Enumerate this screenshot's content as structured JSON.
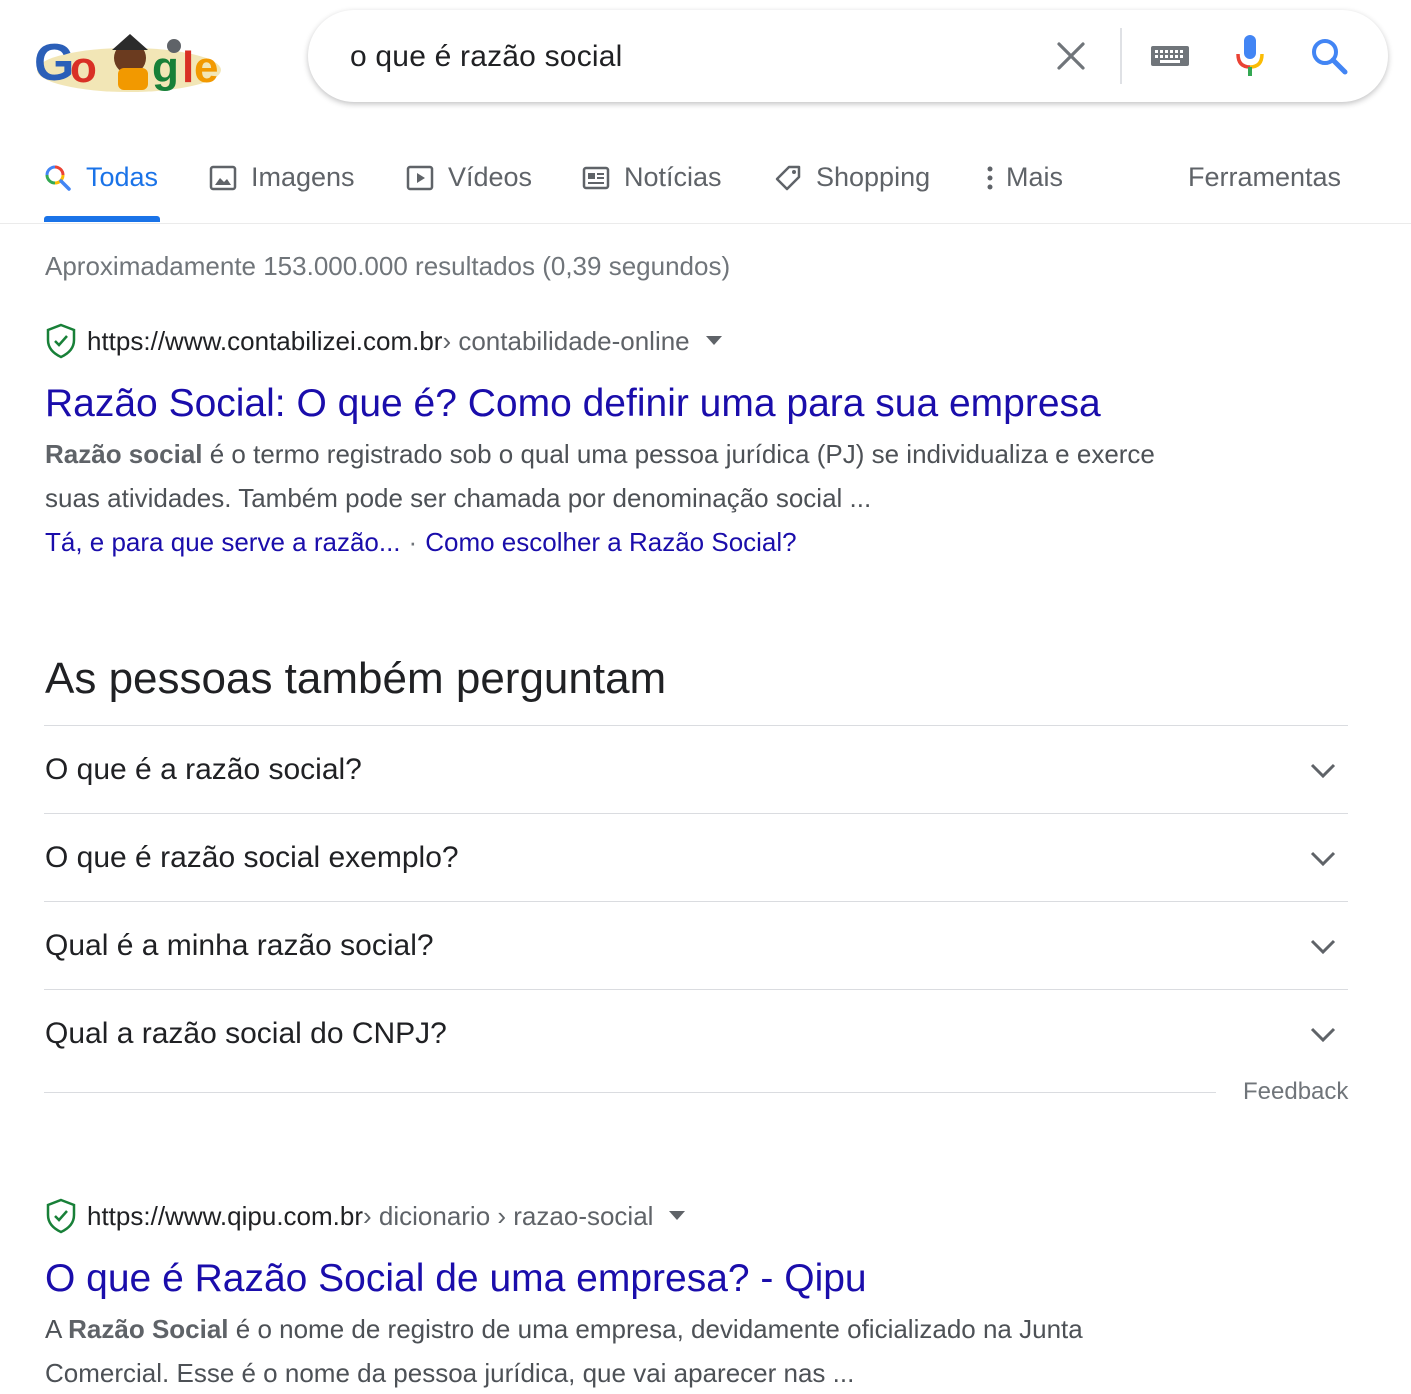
{
  "search": {
    "query": "o que é razão social"
  },
  "tabs": [
    {
      "label": "Todas",
      "icon": "search-icon",
      "active": true
    },
    {
      "label": "Imagens",
      "icon": "image-icon"
    },
    {
      "label": "Vídeos",
      "icon": "video-icon"
    },
    {
      "label": "Notícias",
      "icon": "news-icon"
    },
    {
      "label": "Shopping",
      "icon": "tag-icon"
    },
    {
      "label": "Mais",
      "icon": "more-vert-icon"
    }
  ],
  "tools_label": "Ferramentas",
  "stats": "Aproximadamente 153.000.000 resultados (0,39 segundos)",
  "results": [
    {
      "site": "https://www.contabilizei.com.br",
      "crumbs": " › contabilidade-online",
      "title": "Razão Social: O que é? Como definir uma para sua empresa",
      "snippet_bold": "Razão social",
      "snippet_line1_rest": " é o termo registrado sob o qual uma pessoa jurídica (PJ) se individualiza e exerce",
      "snippet_line2": "suas atividades. Também pode ser chamada por denominação social ...",
      "sitelinks": [
        "Tá, e para que serve a razão...",
        "Como escolher a Razão Social?"
      ],
      "sitelink_sep": "·"
    },
    {
      "site": "https://www.qipu.com.br",
      "crumbs": " › dicionario › razao-social",
      "title": "O que é Razão Social de uma empresa? - Qipu",
      "snippet_prefix": "A ",
      "snippet_bold": "Razão Social",
      "snippet_line1_rest": " é o nome de registro de uma empresa, devidamente oficializado na Junta",
      "snippet_line2": "Comercial. Esse é o nome da pessoa jurídica, que vai aparecer nas ..."
    }
  ],
  "people_also_ask": {
    "title": "As pessoas também perguntam",
    "questions": [
      "O que é a razão social?",
      "O que é razão social exemplo?",
      "Qual é a minha razão social?",
      "Qual a razão social do CNPJ?"
    ],
    "feedback": "Feedback"
  },
  "colors": {
    "link": "#1a0dab",
    "accent": "#1a73e8",
    "secure_green": "#188038"
  }
}
